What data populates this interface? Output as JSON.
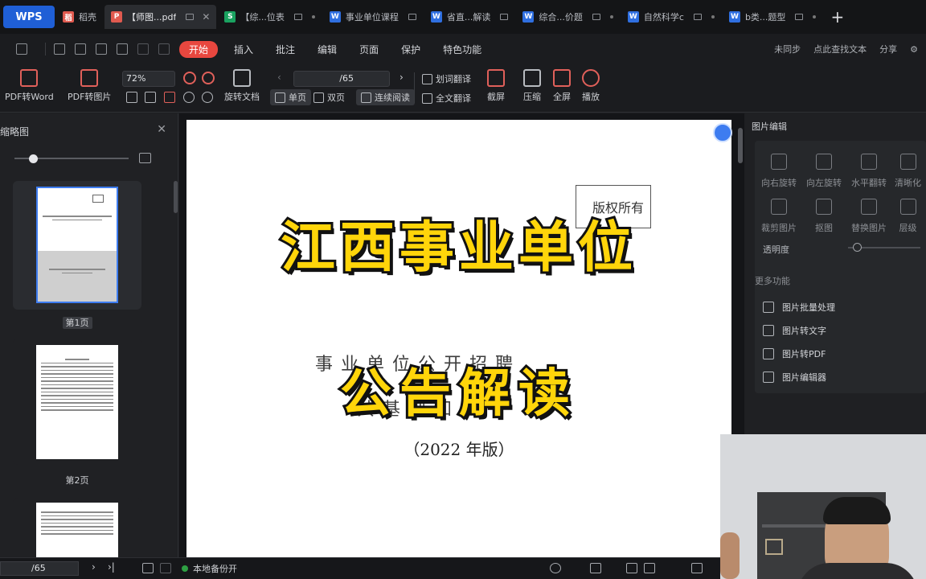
{
  "tabs": {
    "wps": "WPS",
    "items": [
      {
        "label": "稻壳",
        "icon": "docer-icon",
        "color": "#e05a4f"
      },
      {
        "label": "【师图...pdf",
        "icon": "pdf-icon",
        "color": "#e05a4f",
        "active": true
      },
      {
        "label": "【综...位表",
        "icon": "sheet-icon",
        "color": "#1aa260"
      },
      {
        "label": "事业单位课程",
        "icon": "word-icon",
        "color": "#2f6fe0"
      },
      {
        "label": "省直...解读",
        "icon": "word-icon",
        "color": "#2f6fe0"
      },
      {
        "label": "综合...价题",
        "icon": "word-icon",
        "color": "#2f6fe0"
      },
      {
        "label": "自然科学c",
        "icon": "word-icon",
        "color": "#2f6fe0"
      },
      {
        "label": "b类...题型",
        "icon": "word-icon",
        "color": "#2f6fe0"
      }
    ],
    "new_tab": "+"
  },
  "menubar": {
    "items": [
      "开始",
      "插入",
      "批注",
      "编辑",
      "页面",
      "保护",
      "特色功能"
    ],
    "sync": "未同步",
    "search": "点此查找文本",
    "share": "分享"
  },
  "ribbon": {
    "pdf_to_word": "PDF转Word",
    "pdf_to_image": "PDF转图片",
    "zoom": "72%",
    "rotate_doc": "旋转文档",
    "page_input": "/65",
    "single_page": "单页",
    "double_page": "双页",
    "continuous": "连续阅读",
    "word_translate": "划词翻译",
    "full_translate": "全文翻译",
    "screenshot": "截屏",
    "compress": "压缩",
    "fullscreen": "全屏",
    "play": "播放"
  },
  "left_panel": {
    "title": "缩略图",
    "thumbs": [
      "第1页",
      "第2页"
    ]
  },
  "document": {
    "stamp": "版权所有",
    "bg_line1": "事业单位公开招聘",
    "bg_line2": "共基础知识",
    "edition": "（2022 年版）",
    "overlay_line1": "江西事业单位",
    "overlay_line2": "公告解读"
  },
  "right_panel": {
    "title": "图片编辑",
    "tools": [
      "向右旋转",
      "向左旋转",
      "水平翻转",
      "清晰化",
      "裁剪图片",
      "抠图",
      "替换图片",
      "层级"
    ],
    "opacity": "透明度",
    "more": "更多功能",
    "more_items": [
      "图片批量处理",
      "图片转文字",
      "图片转PDF",
      "图片编辑器"
    ]
  },
  "statusbar": {
    "page": "/65",
    "backup": "本地备份开"
  },
  "colors": {
    "accent": "#e8473f",
    "overlay_yellow": "#ffd50a",
    "wps_blue": "#1f5fd6"
  }
}
